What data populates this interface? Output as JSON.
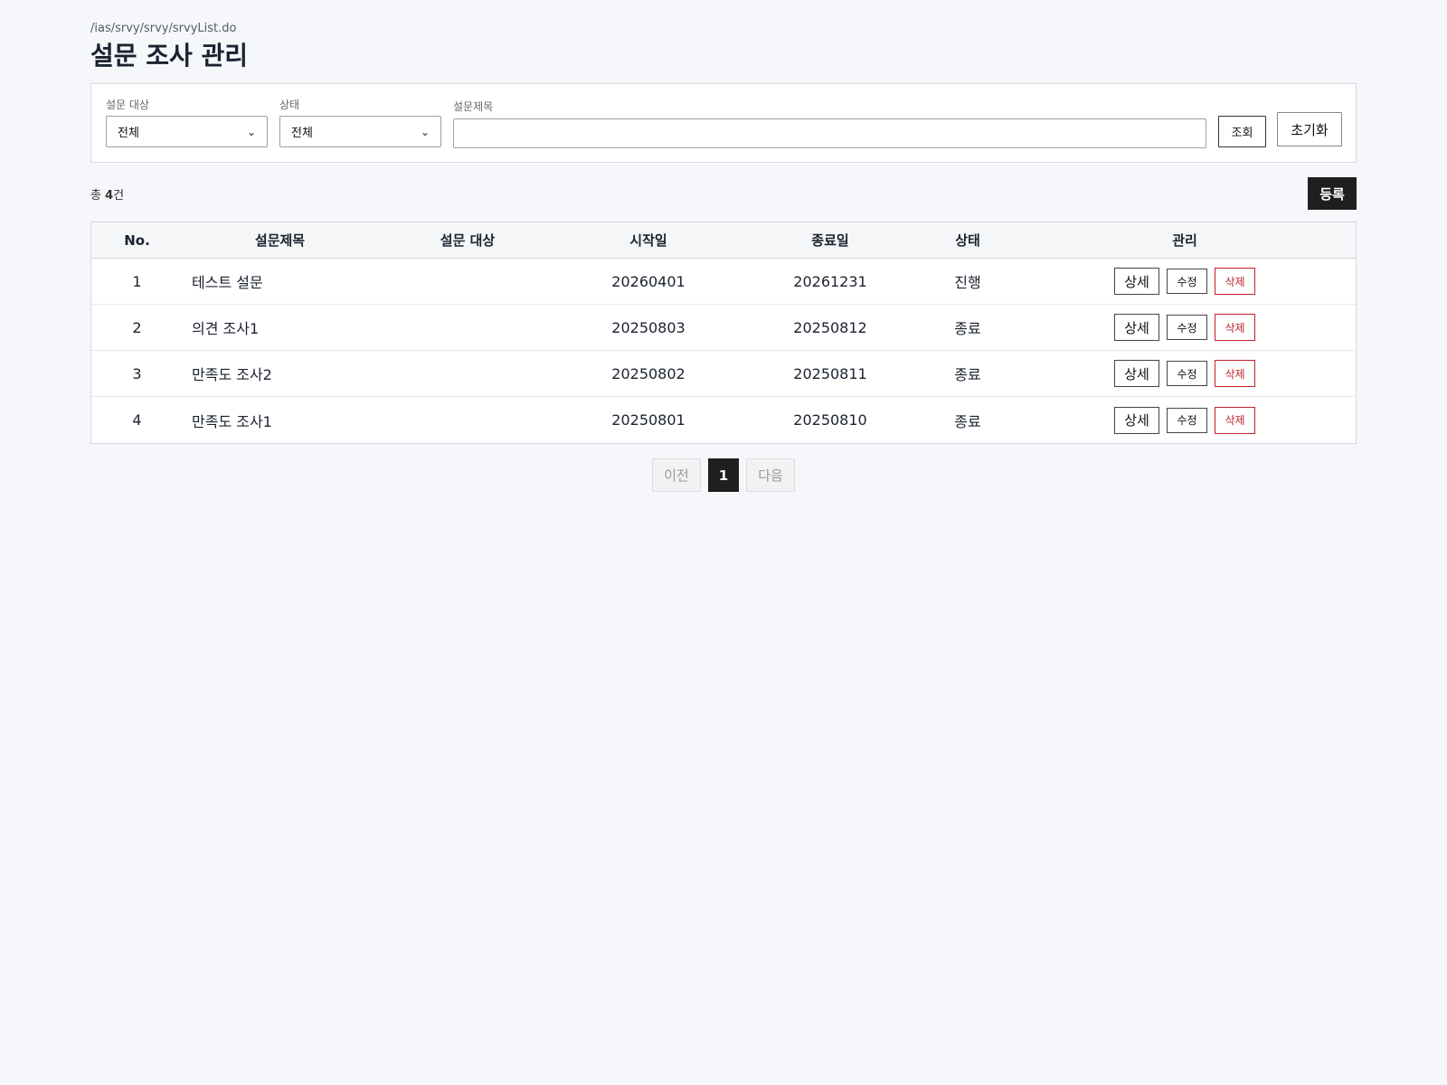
{
  "header": {
    "path": "/ias/srvy/srvy/srvyList.do",
    "title": "설문 조사 관리"
  },
  "search": {
    "target_label": "설문 대상",
    "target_value": "전체",
    "status_label": "상태",
    "status_value": "전체",
    "title_label": "설문제목",
    "title_value": "",
    "search_button": "조회",
    "reset_button": "초기화"
  },
  "summary": {
    "prefix": "총 ",
    "count": "4",
    "suffix": "건",
    "register_button": "등록"
  },
  "table": {
    "headers": {
      "no": "No.",
      "title": "설문제목",
      "target": "설문 대상",
      "start": "시작일",
      "end": "종료일",
      "status": "상태",
      "manage": "관리"
    },
    "rows": [
      {
        "no": "1",
        "title": "테스트 설문",
        "target": "",
        "start": "20260401",
        "end": "20261231",
        "status": "진행"
      },
      {
        "no": "2",
        "title": "의견 조사1",
        "target": "",
        "start": "20250803",
        "end": "20250812",
        "status": "종료"
      },
      {
        "no": "3",
        "title": "만족도 조사2",
        "target": "",
        "start": "20250802",
        "end": "20250811",
        "status": "종료"
      },
      {
        "no": "4",
        "title": "만족도 조사1",
        "target": "",
        "start": "20250801",
        "end": "20250810",
        "status": "종료"
      }
    ],
    "actions": {
      "detail": "상세",
      "edit": "수정",
      "delete": "삭제"
    }
  },
  "pagination": {
    "prev": "이전",
    "current": "1",
    "next": "다음"
  }
}
